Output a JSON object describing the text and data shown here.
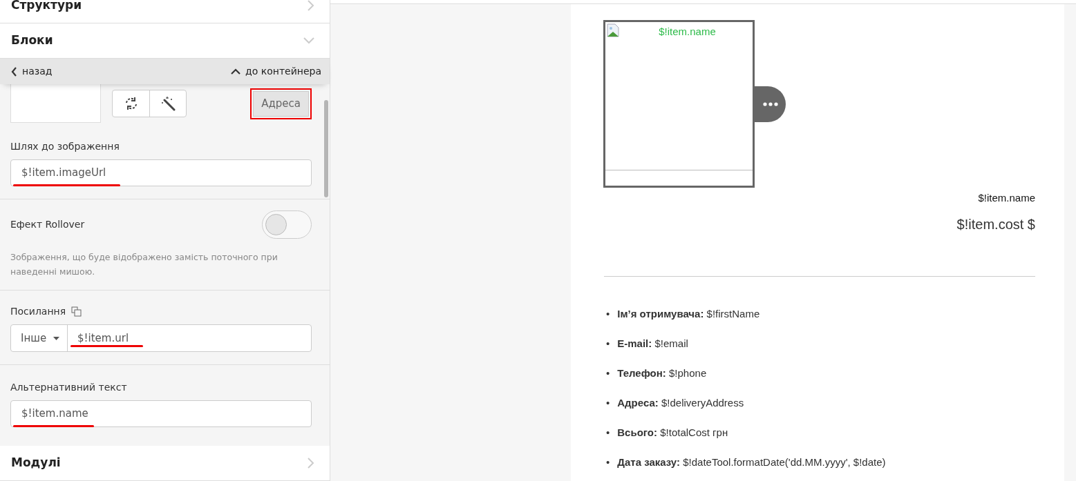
{
  "sections": [
    {
      "title": "Структури",
      "expanded": false
    },
    {
      "title": "Блоки",
      "expanded": true
    }
  ],
  "nav": {
    "back": "назад",
    "up": "до контейнера"
  },
  "image_tools": {
    "address_button": "Адреса",
    "highlighted": true
  },
  "image_path": {
    "label": "Шлях до зображення",
    "value": "$!item.imageUrl",
    "underlined": true
  },
  "rollover": {
    "label": "Ефект Rollover",
    "on": false,
    "hint": "Зображення, що буде відображено замість поточного при наведенні мишою."
  },
  "link": {
    "label": "Посилання",
    "type": "Інше",
    "value": "$!item.url",
    "underlined": true
  },
  "alt_text": {
    "label": "Альтернативний текст",
    "value": "$!item.name",
    "underlined": true
  },
  "bottom_sections": [
    {
      "title": "Модулі",
      "expanded": false
    }
  ],
  "preview": {
    "image_alt": "$!item.name",
    "product_name": "$!item.name",
    "price": "$!item.cost $",
    "details": [
      {
        "marker": "•",
        "label": "Ім’я отримувача:",
        "value": "$!firstName"
      },
      {
        "marker": "•",
        "label": "E-mail:",
        "value": "$!email"
      },
      {
        "marker": "•",
        "label": "Телефон:",
        "value": "$!phone"
      },
      {
        "marker": "•",
        "label": "Адреса:",
        "value": "$!deliveryAddress"
      },
      {
        "marker": "•",
        "label": "Всього:",
        "value": "$!totalCost грн"
      },
      {
        "marker": "•",
        "label": "Дата заказу:",
        "value": "$!dateTool.formatDate('dd.MM.yyyy', $!date)"
      }
    ]
  }
}
